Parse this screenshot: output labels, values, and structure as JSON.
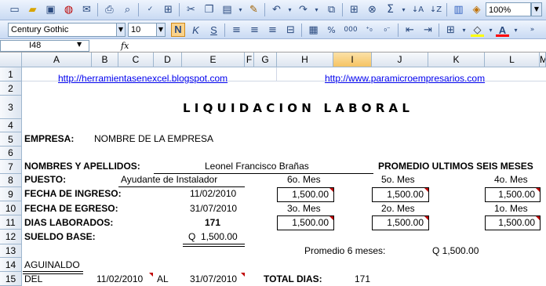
{
  "toolbar": {
    "zoom": "100%",
    "font_name": "Century Gothic",
    "font_size": "10",
    "bold": "N",
    "italic": "K",
    "strike": "S",
    "percent": "%",
    "thousands": "000",
    "sigma": "Σ"
  },
  "formula_bar": {
    "name_box": "I48",
    "fx": "fx",
    "content": ""
  },
  "columns": [
    "A",
    "B",
    "C",
    "D",
    "E",
    "F",
    "G",
    "H",
    "I",
    "J",
    "K",
    "L",
    "M"
  ],
  "rows": [
    "1",
    "2",
    "3",
    "4",
    "5",
    "6",
    "7",
    "8",
    "9",
    "10",
    "11",
    "12",
    "13",
    "14",
    "15"
  ],
  "sheet": {
    "link1": "http://herramientasenexcel.blogspot.com",
    "link2": "http://www.paramicroempresarios.com",
    "title": "L I Q U I D A C I O N   L A B O R A L",
    "empresa_label": "EMPRESA:",
    "empresa_value": "NOMBRE DE LA EMPRESA",
    "nombres_label": "NOMBRES Y APELLIDOS:",
    "nombres_value": "Leonel Francisco Brañas",
    "promedio_header": "PROMEDIO ULTIMOS SEIS MESES",
    "puesto_label": "PUESTO:",
    "puesto_value": "Ayudante de Instalador",
    "mes6": "6o. Mes",
    "mes5": "5o. Mes",
    "mes4": "4o. Mes",
    "ingreso_label": "FECHA DE INGRESO:",
    "ingreso_value": "11/02/2010",
    "val_h9": "1,500.00",
    "val_j9": "1,500.00",
    "val_l9": "1,500.00",
    "egreso_label": "FECHA DE EGRESO:",
    "egreso_value": "31/07/2010",
    "mes3": "3o. Mes",
    "mes2": "2o. Mes",
    "mes1": "1o. Mes",
    "dias_label": "DIAS LABORADOS:",
    "dias_value": "171",
    "val_h11": "1,500.00",
    "val_j11": "1,500.00",
    "val_l11": "1,500.00",
    "sueldo_label": "SUELDO BASE:",
    "sueldo_value": "Q  1,500.00",
    "promedio_label": "Promedio 6 meses:",
    "promedio_value": "Q 1,500.00",
    "aguinaldo": "AGUINALDO",
    "del_label": "DEL",
    "del_value": "11/02/2010",
    "al_label": "AL",
    "al_value": "31/07/2010",
    "total_dias_label": "TOTAL DIAS:",
    "total_dias_value": "171"
  }
}
